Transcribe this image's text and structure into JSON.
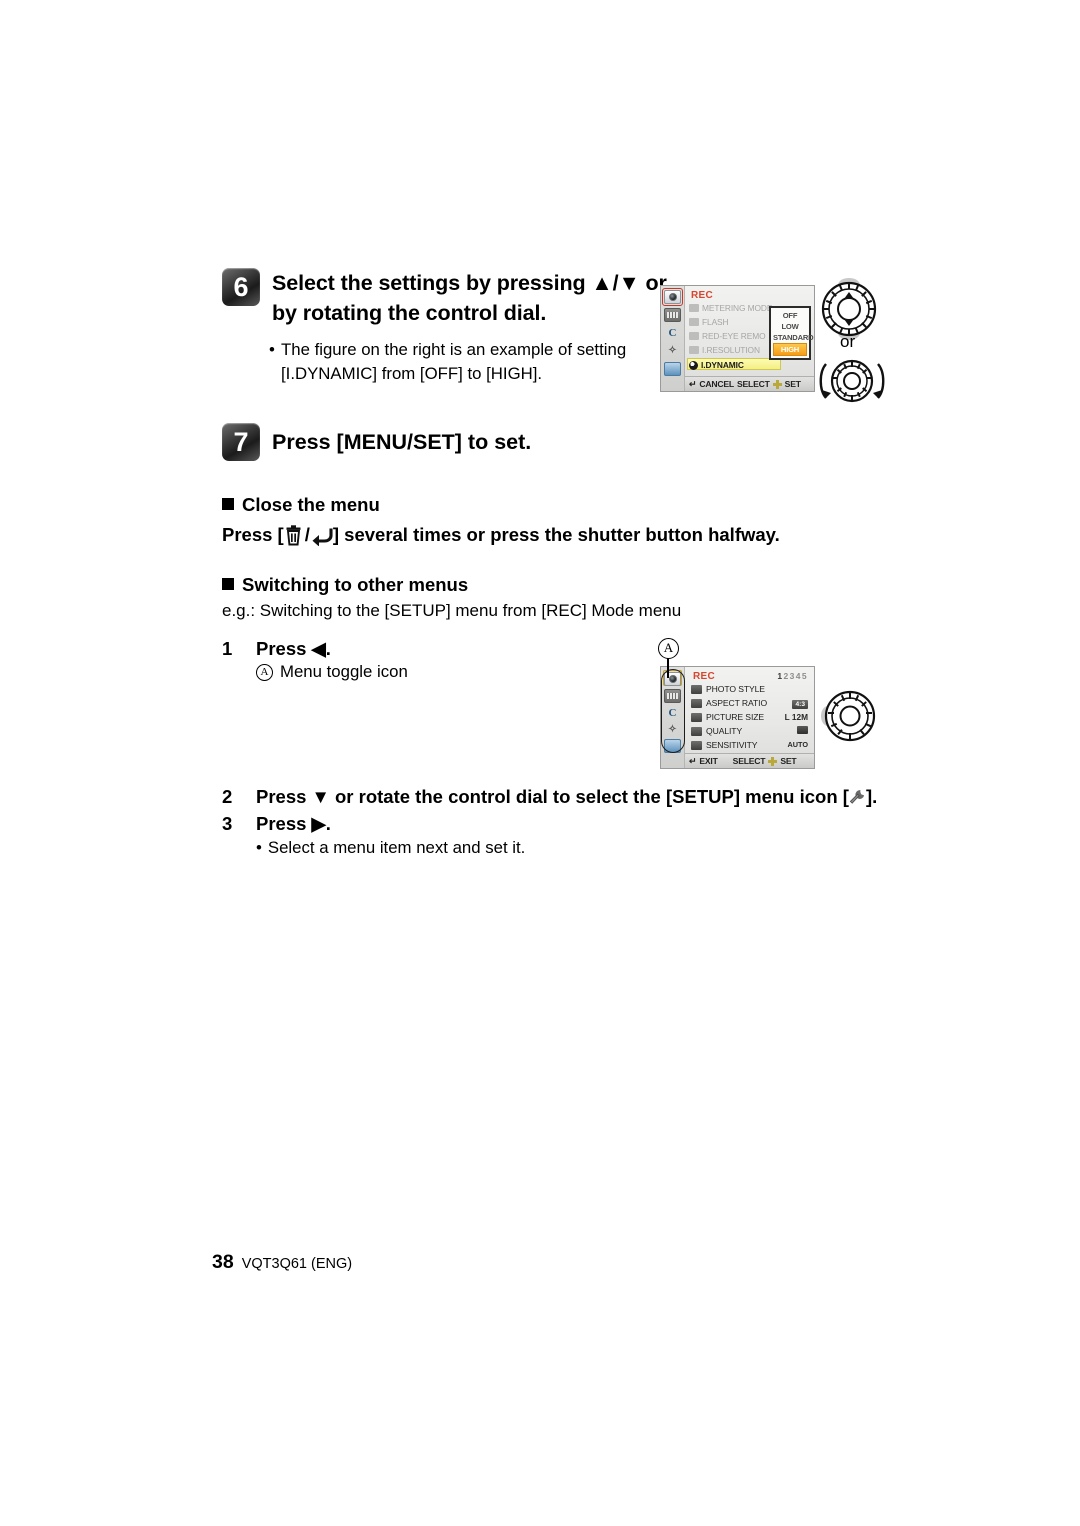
{
  "step6": {
    "number": "6",
    "title": "Select the settings by pressing ▲/▼ or by rotating the control dial.",
    "bullet": "The figure on the right is an example of setting [I.DYNAMIC] from [OFF] to [HIGH]."
  },
  "step7": {
    "number": "7",
    "title": "Press [MENU/SET] to set."
  },
  "close_menu": {
    "heading": "Close the menu",
    "line_prefix": "Press [",
    "line_suffix": "] several times or press the shutter button halfway."
  },
  "switching": {
    "heading": "Switching to other menus",
    "example": "e.g.: Switching to the [SETUP] menu from [REC] Mode menu",
    "steps": [
      {
        "num": "1",
        "text": "Press ◀."
      },
      {
        "num": "2",
        "text": "Press ▼ or rotate the control dial to select the [SETUP] menu icon ["
      },
      {
        "num": "3",
        "text": "Press ▶."
      }
    ],
    "step2_suffix": "].",
    "callout_a_label": "A",
    "callout_a_text": "Menu toggle icon",
    "step3_bullet": "Select a menu item next and set it."
  },
  "lcd1": {
    "title": "REC",
    "rows": [
      {
        "label": "METERING MODE",
        "dim": true
      },
      {
        "label": "FLASH",
        "dim": true
      },
      {
        "label": "RED-EYE REMO",
        "dim": true
      },
      {
        "label": "I.RESOLUTION",
        "dim": true
      },
      {
        "label": "I.DYNAMIC",
        "dim": false
      }
    ],
    "submenu_options": [
      "OFF",
      "LOW",
      "STANDARD",
      "HIGH"
    ],
    "submenu_selected": "HIGH",
    "bottom": {
      "cancel": "CANCEL",
      "select": "SELECT",
      "set": "SET"
    },
    "rail_icons": [
      "camera-icon",
      "movie-icon",
      "custom-c-icon",
      "wrench-icon",
      "playback-icon"
    ]
  },
  "lcd2": {
    "title": "REC",
    "page_indicator_active": "1",
    "page_indicator_rest": "2345",
    "rows": [
      {
        "label": "PHOTO STYLE",
        "value": ""
      },
      {
        "label": "ASPECT RATIO",
        "value": "4:3"
      },
      {
        "label": "PICTURE SIZE",
        "value": "L 12M"
      },
      {
        "label": "QUALITY",
        "value": ""
      },
      {
        "label": "SENSITIVITY",
        "value": "AUTO"
      }
    ],
    "bottom": {
      "exit": "EXIT",
      "select": "SELECT",
      "set": "SET"
    },
    "rail_icons": [
      "camera-icon",
      "movie-icon",
      "custom-c-icon",
      "wrench-icon",
      "playback-icon"
    ]
  },
  "dials": {
    "or_label": "or"
  },
  "footer": {
    "page_number": "38",
    "code": "VQT3Q61 (ENG)"
  }
}
